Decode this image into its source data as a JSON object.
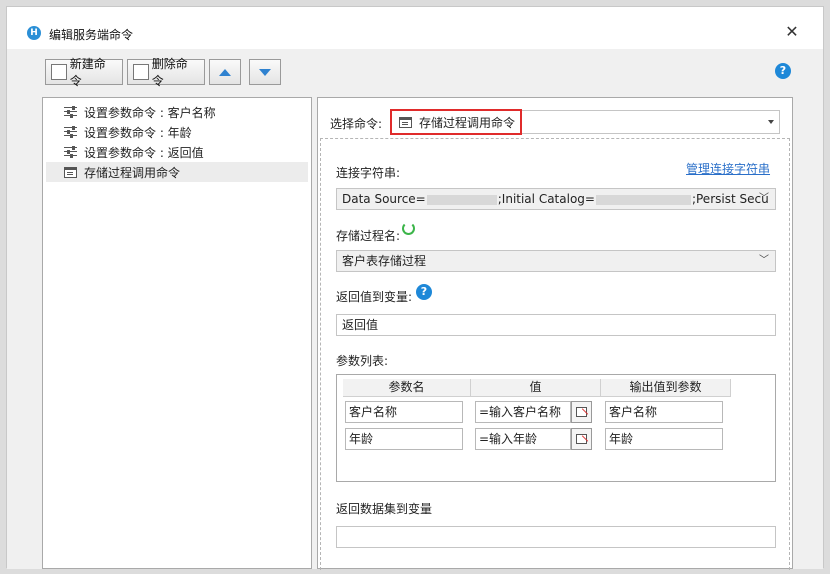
{
  "window": {
    "title": "编辑服务端命令",
    "app_icon_letter": "H"
  },
  "toolbar": {
    "new_label": "新建命令",
    "delete_label": "删除命令"
  },
  "tree": {
    "items": [
      {
        "label": "设置参数命令 : 客户名称",
        "icon": "sliders-icon"
      },
      {
        "label": "设置参数命令 : 年龄",
        "icon": "sliders-icon"
      },
      {
        "label": "设置参数命令 : 返回值",
        "icon": "sliders-icon"
      },
      {
        "label": "存储过程调用命令",
        "icon": "command-icon",
        "selected": true
      }
    ]
  },
  "form": {
    "select_label": "选择命令:",
    "select_value": "存储过程调用命令",
    "conn_label": "连接字符串:",
    "manage_link": "管理连接字符串",
    "conn_part1": "Data Source=",
    "conn_part2": ";Initial Catalog=",
    "conn_part3": ";Persist Secu",
    "proc_label": "存储过程名:",
    "proc_value": "客户表存储过程",
    "return_label": "返回值到变量:",
    "return_value": "返回值",
    "params_label": "参数列表:",
    "dataset_label": "返回数据集到变量",
    "dataset_value": ""
  },
  "params": {
    "headers": [
      "参数名",
      "值",
      "输出值到参数"
    ],
    "rows": [
      [
        "客户名称",
        "=输入客户名称",
        "客户名称"
      ],
      [
        "年龄",
        "=输入年龄",
        "年龄"
      ]
    ]
  },
  "colors": {
    "accent": "#2b8fd6",
    "highlight_border": "#e02b2b",
    "link": "#2a6fc9"
  }
}
